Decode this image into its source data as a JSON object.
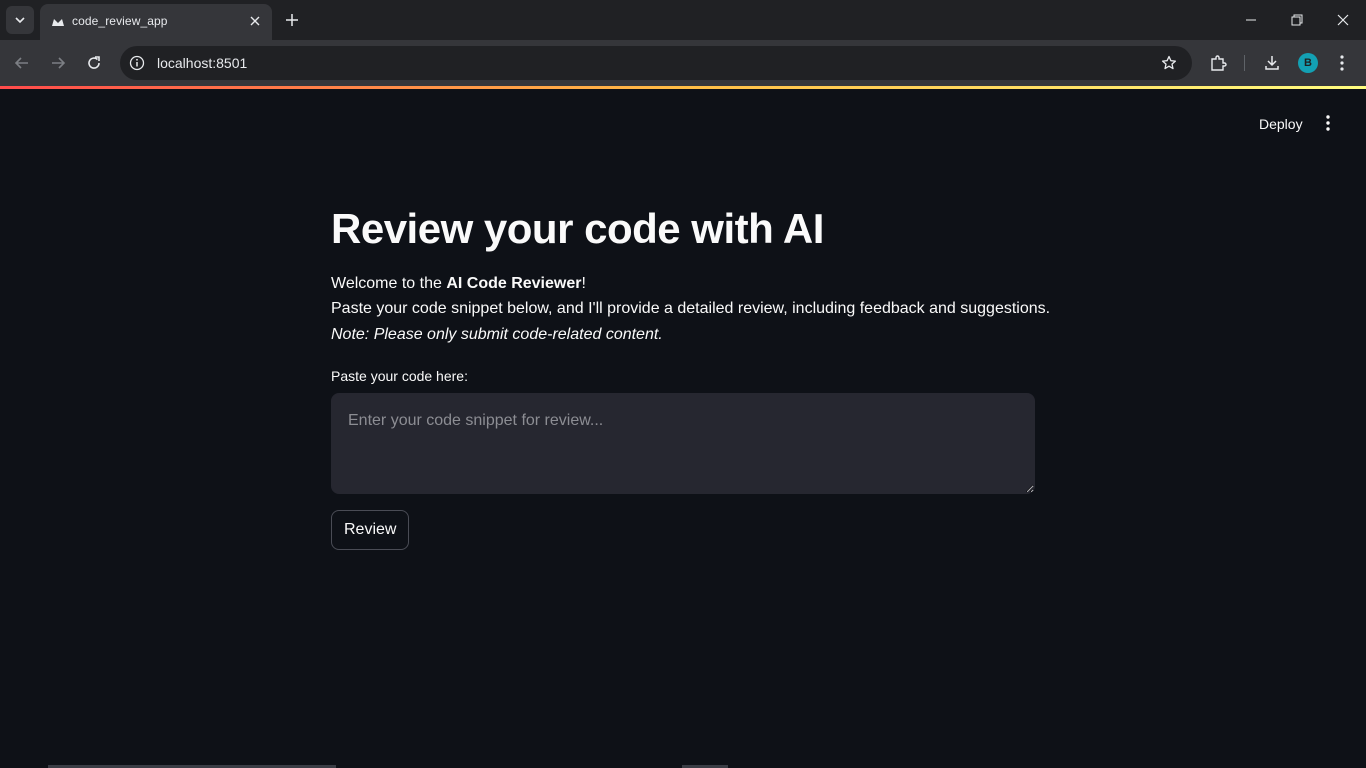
{
  "browser": {
    "tab_title": "code_review_app",
    "url": "localhost:8501",
    "profile_initial": "B"
  },
  "app": {
    "deploy_label": "Deploy",
    "title": "Review your code with AI",
    "welcome_prefix": "Welcome to the ",
    "welcome_bold": "AI Code Reviewer",
    "welcome_suffix": "!",
    "instructions": "Paste your code snippet below, and I'll provide a detailed review, including feedback and suggestions.",
    "note": "Note: Please only submit code-related content.",
    "input_label": "Paste your code here:",
    "input_placeholder": "Enter your code snippet for review...",
    "input_value": "",
    "review_button": "Review"
  },
  "colors": {
    "background": "#0e1117",
    "input_bg": "#262730",
    "accent": "#ff4b4b",
    "avatar": "#13a0b3"
  }
}
